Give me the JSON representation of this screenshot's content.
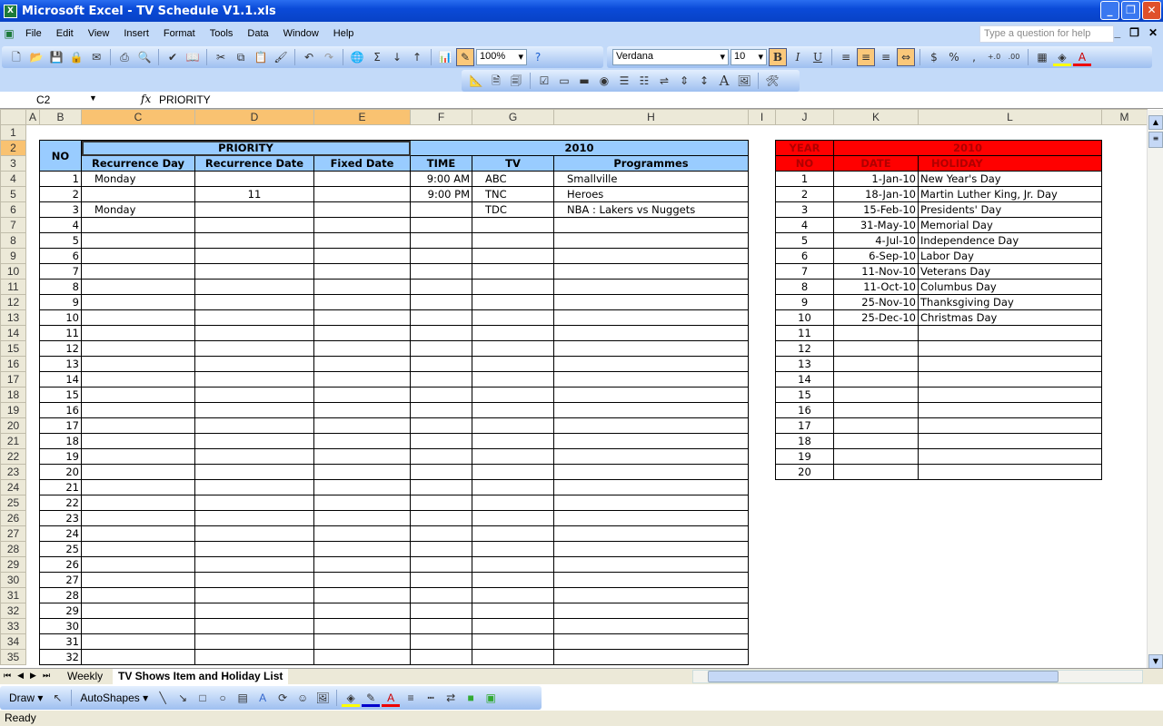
{
  "window": {
    "title": "Microsoft Excel - TV Schedule V1.1.xls",
    "minimize": "_",
    "restore": "❐",
    "close": "✕"
  },
  "menu": [
    "File",
    "Edit",
    "View",
    "Insert",
    "Format",
    "Tools",
    "Data",
    "Window",
    "Help"
  ],
  "help_placeholder": "Type a question for help",
  "toolbar": {
    "zoom": "100%",
    "font": "Verdana",
    "font_size": "10",
    "bold": "B",
    "italic": "I",
    "underline": "U",
    "currency": "$",
    "percent": "%",
    "comma": ","
  },
  "formula_bar": {
    "name_box": "C2",
    "fx": "fx",
    "value": "PRIORITY"
  },
  "columns": [
    "A",
    "B",
    "C",
    "D",
    "E",
    "F",
    "G",
    "H",
    "I",
    "J",
    "K",
    "L",
    "M"
  ],
  "schedule": {
    "header_no": "NO",
    "priority": "PRIORITY",
    "year": "2010",
    "subheaders": [
      "Recurrence Day",
      "Recurrence Date",
      "Fixed Date",
      "TIME",
      "TV",
      "Programmes"
    ],
    "numbers": [
      1,
      2,
      3,
      4,
      5,
      6,
      7,
      8,
      9,
      10,
      11,
      12,
      13,
      14,
      15,
      16,
      17,
      18,
      19,
      20,
      21,
      22,
      23,
      24,
      25,
      26,
      27,
      28,
      29,
      30,
      31,
      32
    ],
    "entries": [
      {
        "rec_day": "Monday",
        "rec_date": "",
        "fixed": "",
        "time": "9:00 AM",
        "tv": "ABC",
        "programme": "Smallville"
      },
      {
        "rec_day": "",
        "rec_date": "11",
        "fixed": "",
        "time": "9:00 PM",
        "tv": "TNC",
        "programme": "Heroes"
      },
      {
        "rec_day": "Monday",
        "rec_date": "",
        "fixed": "",
        "time": "",
        "tv": "TDC",
        "programme": "NBA : Lakers vs Nuggets"
      }
    ]
  },
  "holidays": {
    "year_label": "YEAR",
    "year": "2010",
    "no_label": "NO",
    "date_label": "DATE",
    "holiday_label": "HOLIDAY",
    "numbers": [
      1,
      2,
      3,
      4,
      5,
      6,
      7,
      8,
      9,
      10,
      11,
      12,
      13,
      14,
      15,
      16,
      17,
      18,
      19,
      20
    ],
    "entries": [
      {
        "date": "1-Jan-10",
        "name": "New Year's Day"
      },
      {
        "date": "18-Jan-10",
        "name": "Martin Luther King, Jr. Day"
      },
      {
        "date": "15-Feb-10",
        "name": "Presidents' Day"
      },
      {
        "date": "31-May-10",
        "name": "Memorial Day"
      },
      {
        "date": "4-Jul-10",
        "name": "Independence Day"
      },
      {
        "date": "6-Sep-10",
        "name": "Labor Day"
      },
      {
        "date": "11-Nov-10",
        "name": "Veterans Day"
      },
      {
        "date": "11-Oct-10",
        "name": "Columbus Day"
      },
      {
        "date": "25-Nov-10",
        "name": "Thanksgiving Day"
      },
      {
        "date": "25-Dec-10",
        "name": "Christmas Day"
      }
    ]
  },
  "sheet_tabs": [
    "Weekly",
    "TV Shows Item and Holiday List"
  ],
  "draw_toolbar": {
    "draw": "Draw ▾",
    "autoshapes": "AutoShapes ▾"
  },
  "status": "Ready",
  "colors": {
    "blue_header": "#99ccff",
    "red_header": "#ff0000",
    "selected_header": "#f9c271"
  }
}
